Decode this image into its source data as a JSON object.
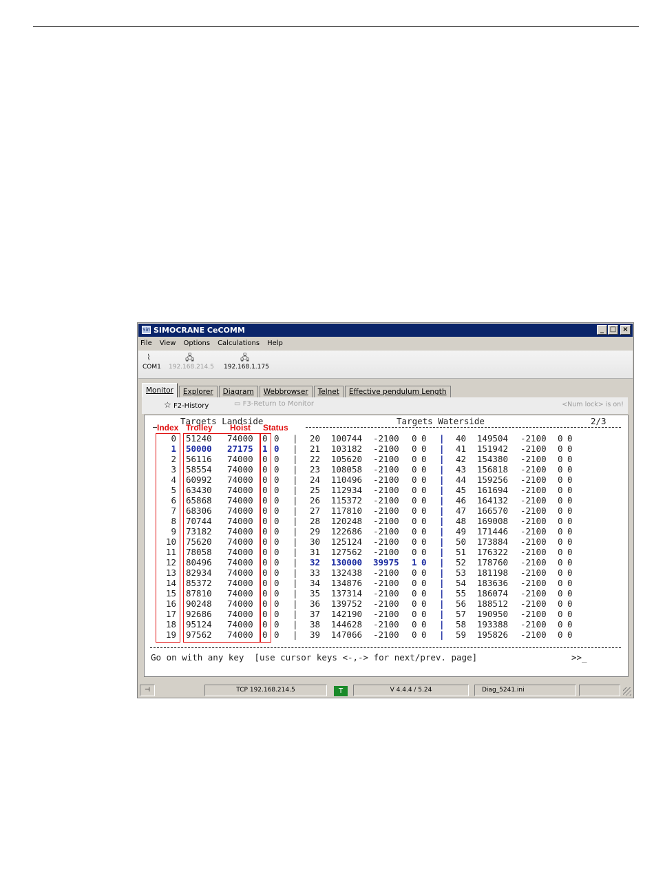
{
  "window": {
    "title": "SIMOCRANE CeCOMM",
    "app_icon_text": "Sim",
    "buttons": {
      "minimize": "_",
      "maximize": "□",
      "close": "×"
    }
  },
  "menu": [
    "File",
    "View",
    "Options",
    "Calculations",
    "Help"
  ],
  "toolbar": {
    "com_label": "COM1",
    "ip_disabled": "192.168.214.5",
    "ip_active": "192.168.1.175"
  },
  "tabs": [
    "Monitor",
    "Explorer",
    "Diagram",
    "Webbrowser",
    "Telnet",
    "Effective pendulum Length"
  ],
  "active_tab": "Monitor",
  "subbar": {
    "history": "F2-History",
    "return": "F3-Return to Monitor",
    "numlock": "<Num lock> is on!"
  },
  "terminal": {
    "header_landside": "Targets Landside",
    "header_waterside": "Targets Waterside",
    "page": "2/3",
    "col_labels": {
      "index": "Index",
      "trolley": "Trolley",
      "hoist": "Hoist",
      "status": "Status"
    },
    "landside": [
      [
        "0",
        "51240",
        "74000",
        "0",
        "0"
      ],
      [
        "1",
        "50000",
        "27175",
        "1",
        "0"
      ],
      [
        "2",
        "56116",
        "74000",
        "0",
        "0"
      ],
      [
        "3",
        "58554",
        "74000",
        "0",
        "0"
      ],
      [
        "4",
        "60992",
        "74000",
        "0",
        "0"
      ],
      [
        "5",
        "63430",
        "74000",
        "0",
        "0"
      ],
      [
        "6",
        "65868",
        "74000",
        "0",
        "0"
      ],
      [
        "7",
        "68306",
        "74000",
        "0",
        "0"
      ],
      [
        "8",
        "70744",
        "74000",
        "0",
        "0"
      ],
      [
        "9",
        "73182",
        "74000",
        "0",
        "0"
      ],
      [
        "10",
        "75620",
        "74000",
        "0",
        "0"
      ],
      [
        "11",
        "78058",
        "74000",
        "0",
        "0"
      ],
      [
        "12",
        "80496",
        "74000",
        "0",
        "0"
      ],
      [
        "13",
        "82934",
        "74000",
        "0",
        "0"
      ],
      [
        "14",
        "85372",
        "74000",
        "0",
        "0"
      ],
      [
        "15",
        "87810",
        "74000",
        "0",
        "0"
      ],
      [
        "16",
        "90248",
        "74000",
        "0",
        "0"
      ],
      [
        "17",
        "92686",
        "74000",
        "0",
        "0"
      ],
      [
        "18",
        "95124",
        "74000",
        "0",
        "0"
      ],
      [
        "19",
        "97562",
        "74000",
        "0",
        "0"
      ]
    ],
    "landside_highlight_row": 1,
    "waterside1": [
      [
        "20",
        "100744",
        "-2100",
        "0",
        "0"
      ],
      [
        "21",
        "103182",
        "-2100",
        "0",
        "0"
      ],
      [
        "22",
        "105620",
        "-2100",
        "0",
        "0"
      ],
      [
        "23",
        "108058",
        "-2100",
        "0",
        "0"
      ],
      [
        "24",
        "110496",
        "-2100",
        "0",
        "0"
      ],
      [
        "25",
        "112934",
        "-2100",
        "0",
        "0"
      ],
      [
        "26",
        "115372",
        "-2100",
        "0",
        "0"
      ],
      [
        "27",
        "117810",
        "-2100",
        "0",
        "0"
      ],
      [
        "28",
        "120248",
        "-2100",
        "0",
        "0"
      ],
      [
        "29",
        "122686",
        "-2100",
        "0",
        "0"
      ],
      [
        "30",
        "125124",
        "-2100",
        "0",
        "0"
      ],
      [
        "31",
        "127562",
        "-2100",
        "0",
        "0"
      ],
      [
        "32",
        "130000",
        "39975",
        "1",
        "0"
      ],
      [
        "33",
        "132438",
        "-2100",
        "0",
        "0"
      ],
      [
        "34",
        "134876",
        "-2100",
        "0",
        "0"
      ],
      [
        "35",
        "137314",
        "-2100",
        "0",
        "0"
      ],
      [
        "36",
        "139752",
        "-2100",
        "0",
        "0"
      ],
      [
        "37",
        "142190",
        "-2100",
        "0",
        "0"
      ],
      [
        "38",
        "144628",
        "-2100",
        "0",
        "0"
      ],
      [
        "39",
        "147066",
        "-2100",
        "0",
        "0"
      ]
    ],
    "waterside1_highlight_row": 12,
    "waterside2": [
      [
        "40",
        "149504",
        "-2100",
        "0",
        "0"
      ],
      [
        "41",
        "151942",
        "-2100",
        "0",
        "0"
      ],
      [
        "42",
        "154380",
        "-2100",
        "0",
        "0"
      ],
      [
        "43",
        "156818",
        "-2100",
        "0",
        "0"
      ],
      [
        "44",
        "159256",
        "-2100",
        "0",
        "0"
      ],
      [
        "45",
        "161694",
        "-2100",
        "0",
        "0"
      ],
      [
        "46",
        "164132",
        "-2100",
        "0",
        "0"
      ],
      [
        "47",
        "166570",
        "-2100",
        "0",
        "0"
      ],
      [
        "48",
        "169008",
        "-2100",
        "0",
        "0"
      ],
      [
        "49",
        "171446",
        "-2100",
        "0",
        "0"
      ],
      [
        "50",
        "173884",
        "-2100",
        "0",
        "0"
      ],
      [
        "51",
        "176322",
        "-2100",
        "0",
        "0"
      ],
      [
        "52",
        "178760",
        "-2100",
        "0",
        "0"
      ],
      [
        "53",
        "181198",
        "-2100",
        "0",
        "0"
      ],
      [
        "54",
        "183636",
        "-2100",
        "0",
        "0"
      ],
      [
        "55",
        "186074",
        "-2100",
        "0",
        "0"
      ],
      [
        "56",
        "188512",
        "-2100",
        "0",
        "0"
      ],
      [
        "57",
        "190950",
        "-2100",
        "0",
        "0"
      ],
      [
        "58",
        "193388",
        "-2100",
        "0",
        "0"
      ],
      [
        "59",
        "195826",
        "-2100",
        "0",
        "0"
      ]
    ],
    "separator": "|",
    "prompt": "Go on with any key  [use cursor keys <-,-> for next/prev. page]",
    "prompt_tail": ">>_"
  },
  "statusbar": {
    "connection": "TCP 192.168.214.5",
    "indicator": "T",
    "version": "V 4.4.4 / 5.24",
    "file": "Diag_5241.ini"
  }
}
